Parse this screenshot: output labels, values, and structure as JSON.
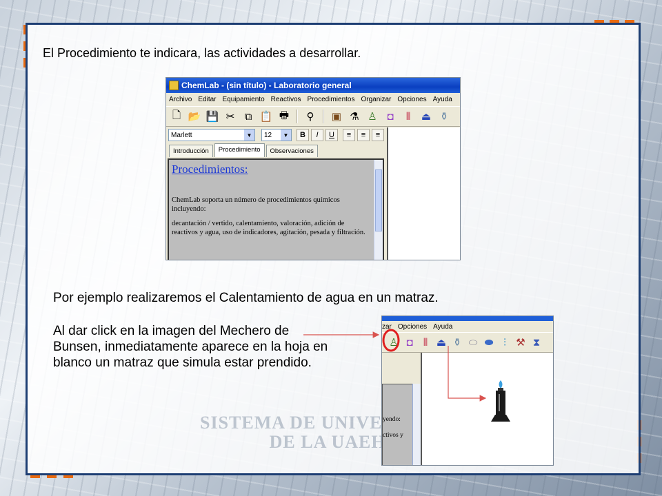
{
  "slide": {
    "intro_text": "El Procedimiento te indicara, las actividades a desarrollar.",
    "example_text": "Por ejemplo realizaremos el Calentamiento de agua en un matraz.",
    "explanation_text": "Al dar click en la imagen del Mechero de Bunsen, inmediatamente aparece en la hoja en blanco un matraz que simula estar prendido.",
    "watermark_line1": "SISTEMA DE UNIVERSIDAD",
    "watermark_line2": "DE LA UAEH"
  },
  "chemlab": {
    "title": "ChemLab - (sin título) - Laboratorio general",
    "menu": [
      "Archivo",
      "Editar",
      "Equipamiento",
      "Reactivos",
      "Procedimientos",
      "Organizar",
      "Opciones",
      "Ayuda"
    ],
    "font_name": "Marlett",
    "font_size": "12",
    "bold_label": "B",
    "italic_label": "I",
    "underline_label": "U",
    "tabs": [
      "Introducción",
      "Procedimiento",
      "Observaciones"
    ],
    "active_tab": "Procedimiento",
    "heading": "Procedimientos:",
    "para1": "ChemLab soporta un número de procedimientos químicos incluyendo:",
    "para2": "decantación / vertido, calentamiento, valoración, adición de reactivos y agua, uso de indicadores, agitación, pesada y filtración."
  },
  "zoom_view": {
    "menu": [
      "zar",
      "Opciones",
      "Ayuda"
    ],
    "text_line1": "yendo:",
    "text_line2": "ctivos y"
  },
  "colors": {
    "frame_border": "#1d3e73",
    "accent_orange": "#e96a10",
    "annotation_red": "#d9534f"
  }
}
